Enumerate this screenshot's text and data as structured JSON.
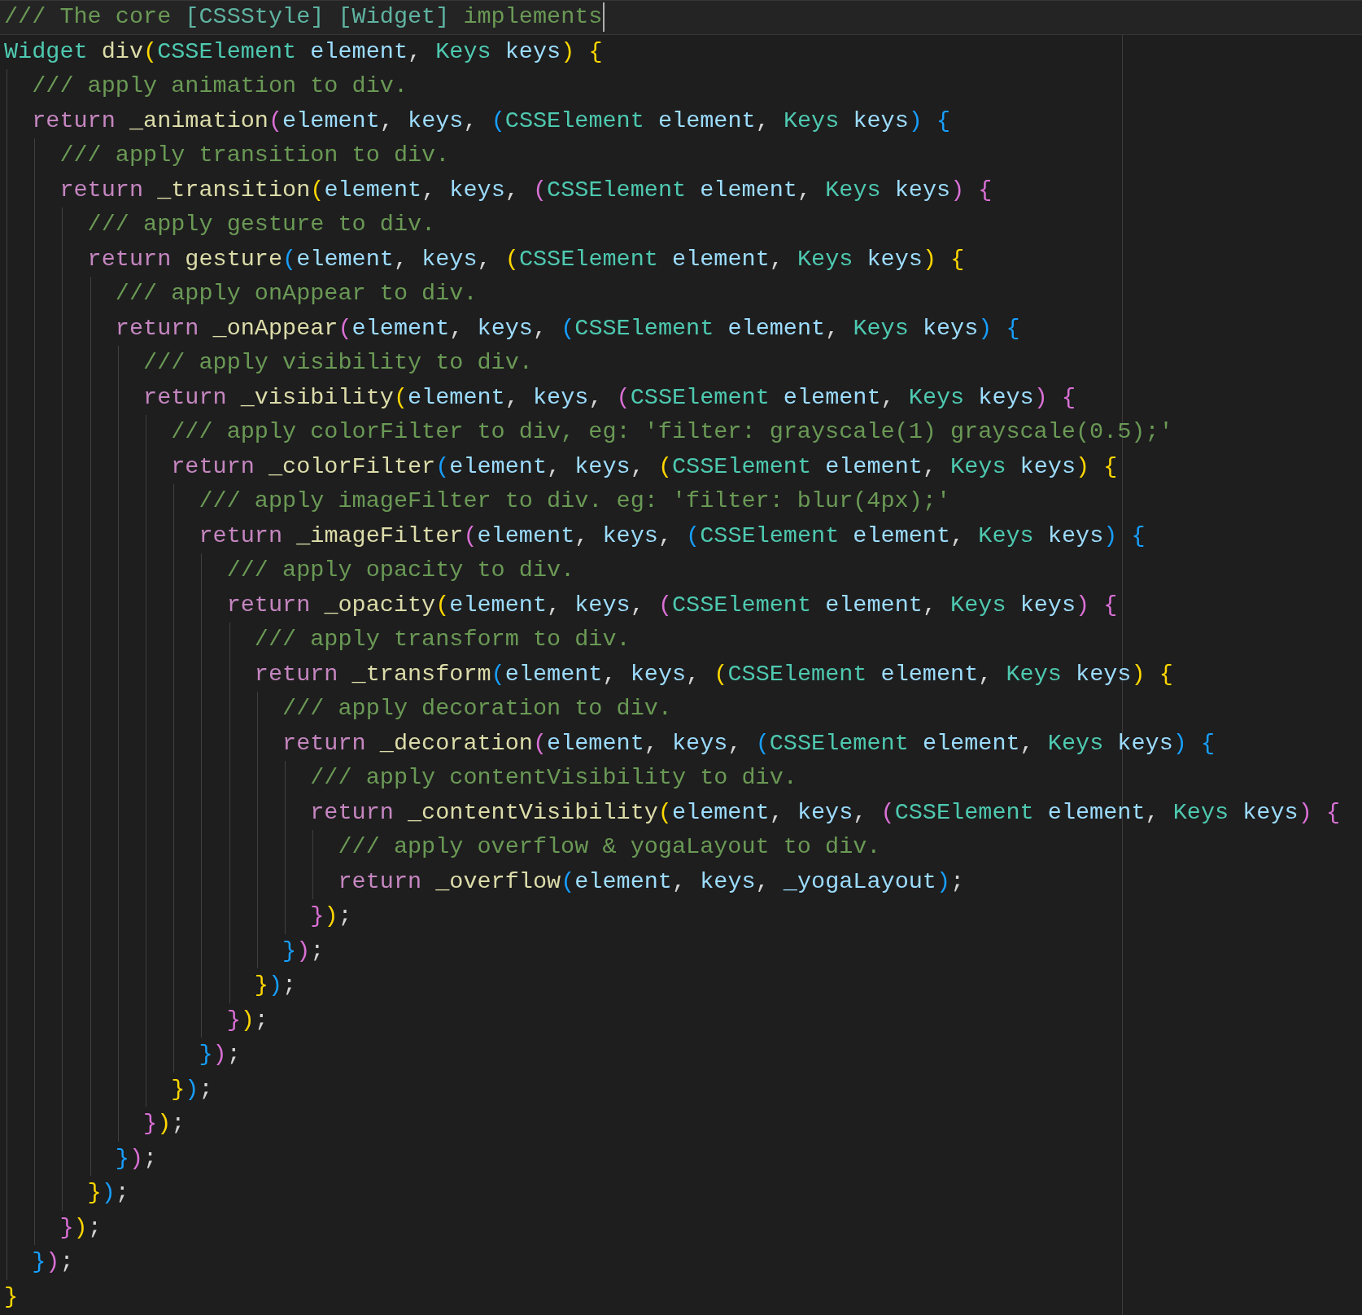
{
  "editor": {
    "lines": [
      {
        "current": true,
        "segments": [
          {
            "text": "/// The core ",
            "color": "#6a9955"
          },
          {
            "text": "[CSSStyle] ",
            "color": "#5fb3a1"
          },
          {
            "text": "[Widget]",
            "color": "#5fb3a1"
          },
          {
            "text": " implements",
            "color": "#6a9955"
          }
        ]
      },
      {
        "current": false,
        "segments": [
          {
            "text": "Widget ",
            "color": "#4ec9b0"
          },
          {
            "text": "div",
            "color": "#dcdcaa"
          },
          {
            "text": "(",
            "color": "#ffd700"
          },
          {
            "text": "CSSElement ",
            "color": "#4ec9b0"
          },
          {
            "text": "element",
            "color": "#9cdcfe"
          },
          {
            "text": ", ",
            "color": "#d4d4d4"
          },
          {
            "text": "Keys ",
            "color": "#4ec9b0"
          },
          {
            "text": "keys",
            "color": "#9cdcfe"
          },
          {
            "text": ")",
            "color": "#ffd700"
          },
          {
            "text": " {",
            "color": "#ffd700"
          }
        ]
      },
      {
        "current": false,
        "segments": [
          {
            "text": "  /// apply animation to div.",
            "color": "#6a9955"
          }
        ]
      },
      {
        "current": false,
        "segments": [
          {
            "text": "  return ",
            "color": "#c586c0"
          },
          {
            "text": "_animation",
            "color": "#dcdcaa"
          },
          {
            "text": "(",
            "color": "#da70d6"
          },
          {
            "text": "element",
            "color": "#9cdcfe"
          },
          {
            "text": ", ",
            "color": "#d4d4d4"
          },
          {
            "text": "keys",
            "color": "#9cdcfe"
          },
          {
            "text": ", ",
            "color": "#d4d4d4"
          },
          {
            "text": "(",
            "color": "#179fff"
          },
          {
            "text": "CSSElement ",
            "color": "#4ec9b0"
          },
          {
            "text": "element",
            "color": "#9cdcfe"
          },
          {
            "text": ", ",
            "color": "#d4d4d4"
          },
          {
            "text": "Keys ",
            "color": "#4ec9b0"
          },
          {
            "text": "keys",
            "color": "#9cdcfe"
          },
          {
            "text": ")",
            "color": "#179fff"
          },
          {
            "text": " {",
            "color": "#179fff"
          }
        ]
      },
      {
        "current": false,
        "segments": [
          {
            "text": "    /// apply transition to div.",
            "color": "#6a9955"
          }
        ]
      },
      {
        "current": false,
        "segments": [
          {
            "text": "    return ",
            "color": "#c586c0"
          },
          {
            "text": "_transition",
            "color": "#dcdcaa"
          },
          {
            "text": "(",
            "color": "#ffd700"
          },
          {
            "text": "element",
            "color": "#9cdcfe"
          },
          {
            "text": ", ",
            "color": "#d4d4d4"
          },
          {
            "text": "keys",
            "color": "#9cdcfe"
          },
          {
            "text": ", ",
            "color": "#d4d4d4"
          },
          {
            "text": "(",
            "color": "#da70d6"
          },
          {
            "text": "CSSElement ",
            "color": "#4ec9b0"
          },
          {
            "text": "element",
            "color": "#9cdcfe"
          },
          {
            "text": ", ",
            "color": "#d4d4d4"
          },
          {
            "text": "Keys ",
            "color": "#4ec9b0"
          },
          {
            "text": "keys",
            "color": "#9cdcfe"
          },
          {
            "text": ")",
            "color": "#da70d6"
          },
          {
            "text": " {",
            "color": "#da70d6"
          }
        ]
      },
      {
        "current": false,
        "segments": [
          {
            "text": "      /// apply gesture to div.",
            "color": "#6a9955"
          }
        ]
      },
      {
        "current": false,
        "segments": [
          {
            "text": "      return ",
            "color": "#c586c0"
          },
          {
            "text": "gesture",
            "color": "#dcdcaa"
          },
          {
            "text": "(",
            "color": "#179fff"
          },
          {
            "text": "element",
            "color": "#9cdcfe"
          },
          {
            "text": ", ",
            "color": "#d4d4d4"
          },
          {
            "text": "keys",
            "color": "#9cdcfe"
          },
          {
            "text": ", ",
            "color": "#d4d4d4"
          },
          {
            "text": "(",
            "color": "#ffd700"
          },
          {
            "text": "CSSElement ",
            "color": "#4ec9b0"
          },
          {
            "text": "element",
            "color": "#9cdcfe"
          },
          {
            "text": ", ",
            "color": "#d4d4d4"
          },
          {
            "text": "Keys ",
            "color": "#4ec9b0"
          },
          {
            "text": "keys",
            "color": "#9cdcfe"
          },
          {
            "text": ")",
            "color": "#ffd700"
          },
          {
            "text": " {",
            "color": "#ffd700"
          }
        ]
      },
      {
        "current": false,
        "segments": [
          {
            "text": "        /// apply onAppear to div.",
            "color": "#6a9955"
          }
        ]
      },
      {
        "current": false,
        "segments": [
          {
            "text": "        return ",
            "color": "#c586c0"
          },
          {
            "text": "_onAppear",
            "color": "#dcdcaa"
          },
          {
            "text": "(",
            "color": "#da70d6"
          },
          {
            "text": "element",
            "color": "#9cdcfe"
          },
          {
            "text": ", ",
            "color": "#d4d4d4"
          },
          {
            "text": "keys",
            "color": "#9cdcfe"
          },
          {
            "text": ", ",
            "color": "#d4d4d4"
          },
          {
            "text": "(",
            "color": "#179fff"
          },
          {
            "text": "CSSElement ",
            "color": "#4ec9b0"
          },
          {
            "text": "element",
            "color": "#9cdcfe"
          },
          {
            "text": ", ",
            "color": "#d4d4d4"
          },
          {
            "text": "Keys ",
            "color": "#4ec9b0"
          },
          {
            "text": "keys",
            "color": "#9cdcfe"
          },
          {
            "text": ")",
            "color": "#179fff"
          },
          {
            "text": " {",
            "color": "#179fff"
          }
        ]
      },
      {
        "current": false,
        "segments": [
          {
            "text": "          /// apply visibility to div.",
            "color": "#6a9955"
          }
        ]
      },
      {
        "current": false,
        "segments": [
          {
            "text": "          return ",
            "color": "#c586c0"
          },
          {
            "text": "_visibility",
            "color": "#dcdcaa"
          },
          {
            "text": "(",
            "color": "#ffd700"
          },
          {
            "text": "element",
            "color": "#9cdcfe"
          },
          {
            "text": ", ",
            "color": "#d4d4d4"
          },
          {
            "text": "keys",
            "color": "#9cdcfe"
          },
          {
            "text": ", ",
            "color": "#d4d4d4"
          },
          {
            "text": "(",
            "color": "#da70d6"
          },
          {
            "text": "CSSElement ",
            "color": "#4ec9b0"
          },
          {
            "text": "element",
            "color": "#9cdcfe"
          },
          {
            "text": ", ",
            "color": "#d4d4d4"
          },
          {
            "text": "Keys ",
            "color": "#4ec9b0"
          },
          {
            "text": "keys",
            "color": "#9cdcfe"
          },
          {
            "text": ")",
            "color": "#da70d6"
          },
          {
            "text": " {",
            "color": "#da70d6"
          }
        ]
      },
      {
        "current": false,
        "segments": [
          {
            "text": "            /// apply colorFilter to div, eg: 'filter: grayscale(1) grayscale(0.5);'",
            "color": "#6a9955"
          }
        ]
      },
      {
        "current": false,
        "segments": [
          {
            "text": "            return ",
            "color": "#c586c0"
          },
          {
            "text": "_colorFilter",
            "color": "#dcdcaa"
          },
          {
            "text": "(",
            "color": "#179fff"
          },
          {
            "text": "element",
            "color": "#9cdcfe"
          },
          {
            "text": ", ",
            "color": "#d4d4d4"
          },
          {
            "text": "keys",
            "color": "#9cdcfe"
          },
          {
            "text": ", ",
            "color": "#d4d4d4"
          },
          {
            "text": "(",
            "color": "#ffd700"
          },
          {
            "text": "CSSElement ",
            "color": "#4ec9b0"
          },
          {
            "text": "element",
            "color": "#9cdcfe"
          },
          {
            "text": ", ",
            "color": "#d4d4d4"
          },
          {
            "text": "Keys ",
            "color": "#4ec9b0"
          },
          {
            "text": "keys",
            "color": "#9cdcfe"
          },
          {
            "text": ")",
            "color": "#ffd700"
          },
          {
            "text": " {",
            "color": "#ffd700"
          }
        ]
      },
      {
        "current": false,
        "segments": [
          {
            "text": "              /// apply imageFilter to div. eg: 'filter: blur(4px);'",
            "color": "#6a9955"
          }
        ]
      },
      {
        "current": false,
        "segments": [
          {
            "text": "              return ",
            "color": "#c586c0"
          },
          {
            "text": "_imageFilter",
            "color": "#dcdcaa"
          },
          {
            "text": "(",
            "color": "#da70d6"
          },
          {
            "text": "element",
            "color": "#9cdcfe"
          },
          {
            "text": ", ",
            "color": "#d4d4d4"
          },
          {
            "text": "keys",
            "color": "#9cdcfe"
          },
          {
            "text": ", ",
            "color": "#d4d4d4"
          },
          {
            "text": "(",
            "color": "#179fff"
          },
          {
            "text": "CSSElement ",
            "color": "#4ec9b0"
          },
          {
            "text": "element",
            "color": "#9cdcfe"
          },
          {
            "text": ", ",
            "color": "#d4d4d4"
          },
          {
            "text": "Keys ",
            "color": "#4ec9b0"
          },
          {
            "text": "keys",
            "color": "#9cdcfe"
          },
          {
            "text": ")",
            "color": "#179fff"
          },
          {
            "text": " {",
            "color": "#179fff"
          }
        ]
      },
      {
        "current": false,
        "segments": [
          {
            "text": "                /// apply opacity to div.",
            "color": "#6a9955"
          }
        ]
      },
      {
        "current": false,
        "segments": [
          {
            "text": "                return ",
            "color": "#c586c0"
          },
          {
            "text": "_opacity",
            "color": "#dcdcaa"
          },
          {
            "text": "(",
            "color": "#ffd700"
          },
          {
            "text": "element",
            "color": "#9cdcfe"
          },
          {
            "text": ", ",
            "color": "#d4d4d4"
          },
          {
            "text": "keys",
            "color": "#9cdcfe"
          },
          {
            "text": ", ",
            "color": "#d4d4d4"
          },
          {
            "text": "(",
            "color": "#da70d6"
          },
          {
            "text": "CSSElement ",
            "color": "#4ec9b0"
          },
          {
            "text": "element",
            "color": "#9cdcfe"
          },
          {
            "text": ", ",
            "color": "#d4d4d4"
          },
          {
            "text": "Keys ",
            "color": "#4ec9b0"
          },
          {
            "text": "keys",
            "color": "#9cdcfe"
          },
          {
            "text": ")",
            "color": "#da70d6"
          },
          {
            "text": " {",
            "color": "#da70d6"
          }
        ]
      },
      {
        "current": false,
        "segments": [
          {
            "text": "                  /// apply transform to div.",
            "color": "#6a9955"
          }
        ]
      },
      {
        "current": false,
        "segments": [
          {
            "text": "                  return ",
            "color": "#c586c0"
          },
          {
            "text": "_transform",
            "color": "#dcdcaa"
          },
          {
            "text": "(",
            "color": "#179fff"
          },
          {
            "text": "element",
            "color": "#9cdcfe"
          },
          {
            "text": ", ",
            "color": "#d4d4d4"
          },
          {
            "text": "keys",
            "color": "#9cdcfe"
          },
          {
            "text": ", ",
            "color": "#d4d4d4"
          },
          {
            "text": "(",
            "color": "#ffd700"
          },
          {
            "text": "CSSElement ",
            "color": "#4ec9b0"
          },
          {
            "text": "element",
            "color": "#9cdcfe"
          },
          {
            "text": ", ",
            "color": "#d4d4d4"
          },
          {
            "text": "Keys ",
            "color": "#4ec9b0"
          },
          {
            "text": "keys",
            "color": "#9cdcfe"
          },
          {
            "text": ")",
            "color": "#ffd700"
          },
          {
            "text": " {",
            "color": "#ffd700"
          }
        ]
      },
      {
        "current": false,
        "segments": [
          {
            "text": "                    /// apply decoration to div.",
            "color": "#6a9955"
          }
        ]
      },
      {
        "current": false,
        "segments": [
          {
            "text": "                    return ",
            "color": "#c586c0"
          },
          {
            "text": "_decoration",
            "color": "#dcdcaa"
          },
          {
            "text": "(",
            "color": "#da70d6"
          },
          {
            "text": "element",
            "color": "#9cdcfe"
          },
          {
            "text": ", ",
            "color": "#d4d4d4"
          },
          {
            "text": "keys",
            "color": "#9cdcfe"
          },
          {
            "text": ", ",
            "color": "#d4d4d4"
          },
          {
            "text": "(",
            "color": "#179fff"
          },
          {
            "text": "CSSElement ",
            "color": "#4ec9b0"
          },
          {
            "text": "element",
            "color": "#9cdcfe"
          },
          {
            "text": ", ",
            "color": "#d4d4d4"
          },
          {
            "text": "Keys ",
            "color": "#4ec9b0"
          },
          {
            "text": "keys",
            "color": "#9cdcfe"
          },
          {
            "text": ")",
            "color": "#179fff"
          },
          {
            "text": " {",
            "color": "#179fff"
          }
        ]
      },
      {
        "current": false,
        "segments": [
          {
            "text": "                      /// apply contentVisibility to div.",
            "color": "#6a9955"
          }
        ]
      },
      {
        "current": false,
        "segments": [
          {
            "text": "                      return ",
            "color": "#c586c0"
          },
          {
            "text": "_contentVisibility",
            "color": "#dcdcaa"
          },
          {
            "text": "(",
            "color": "#ffd700"
          },
          {
            "text": "element",
            "color": "#9cdcfe"
          },
          {
            "text": ", ",
            "color": "#d4d4d4"
          },
          {
            "text": "keys",
            "color": "#9cdcfe"
          },
          {
            "text": ", ",
            "color": "#d4d4d4"
          },
          {
            "text": "(",
            "color": "#da70d6"
          },
          {
            "text": "CSSElement ",
            "color": "#4ec9b0"
          },
          {
            "text": "element",
            "color": "#9cdcfe"
          },
          {
            "text": ", ",
            "color": "#d4d4d4"
          },
          {
            "text": "Keys ",
            "color": "#4ec9b0"
          },
          {
            "text": "keys",
            "color": "#9cdcfe"
          },
          {
            "text": ")",
            "color": "#da70d6"
          },
          {
            "text": " {",
            "color": "#da70d6"
          }
        ]
      },
      {
        "current": false,
        "segments": [
          {
            "text": "                        /// apply overflow & yogaLayout to div.",
            "color": "#6a9955"
          }
        ]
      },
      {
        "current": false,
        "segments": [
          {
            "text": "                        return ",
            "color": "#c586c0"
          },
          {
            "text": "_overflow",
            "color": "#dcdcaa"
          },
          {
            "text": "(",
            "color": "#179fff"
          },
          {
            "text": "element",
            "color": "#9cdcfe"
          },
          {
            "text": ", ",
            "color": "#d4d4d4"
          },
          {
            "text": "keys",
            "color": "#9cdcfe"
          },
          {
            "text": ", ",
            "color": "#d4d4d4"
          },
          {
            "text": "_yogaLayout",
            "color": "#9cdcfe"
          },
          {
            "text": ")",
            "color": "#179fff"
          },
          {
            "text": ";",
            "color": "#d4d4d4"
          }
        ]
      },
      {
        "current": false,
        "segments": [
          {
            "text": "                      }",
            "color": "#da70d6"
          },
          {
            "text": ")",
            "color": "#ffd700"
          },
          {
            "text": ";",
            "color": "#d4d4d4"
          }
        ]
      },
      {
        "current": false,
        "segments": [
          {
            "text": "                    }",
            "color": "#179fff"
          },
          {
            "text": ")",
            "color": "#da70d6"
          },
          {
            "text": ";",
            "color": "#d4d4d4"
          }
        ]
      },
      {
        "current": false,
        "segments": [
          {
            "text": "                  }",
            "color": "#ffd700"
          },
          {
            "text": ")",
            "color": "#179fff"
          },
          {
            "text": ";",
            "color": "#d4d4d4"
          }
        ]
      },
      {
        "current": false,
        "segments": [
          {
            "text": "                }",
            "color": "#da70d6"
          },
          {
            "text": ")",
            "color": "#ffd700"
          },
          {
            "text": ";",
            "color": "#d4d4d4"
          }
        ]
      },
      {
        "current": false,
        "segments": [
          {
            "text": "              }",
            "color": "#179fff"
          },
          {
            "text": ")",
            "color": "#da70d6"
          },
          {
            "text": ";",
            "color": "#d4d4d4"
          }
        ]
      },
      {
        "current": false,
        "segments": [
          {
            "text": "            }",
            "color": "#ffd700"
          },
          {
            "text": ")",
            "color": "#179fff"
          },
          {
            "text": ";",
            "color": "#d4d4d4"
          }
        ]
      },
      {
        "current": false,
        "segments": [
          {
            "text": "          }",
            "color": "#da70d6"
          },
          {
            "text": ")",
            "color": "#ffd700"
          },
          {
            "text": ";",
            "color": "#d4d4d4"
          }
        ]
      },
      {
        "current": false,
        "segments": [
          {
            "text": "        }",
            "color": "#179fff"
          },
          {
            "text": ")",
            "color": "#da70d6"
          },
          {
            "text": ";",
            "color": "#d4d4d4"
          }
        ]
      },
      {
        "current": false,
        "segments": [
          {
            "text": "      }",
            "color": "#ffd700"
          },
          {
            "text": ")",
            "color": "#179fff"
          },
          {
            "text": ";",
            "color": "#d4d4d4"
          }
        ]
      },
      {
        "current": false,
        "segments": [
          {
            "text": "    }",
            "color": "#da70d6"
          },
          {
            "text": ")",
            "color": "#ffd700"
          },
          {
            "text": ";",
            "color": "#d4d4d4"
          }
        ]
      },
      {
        "current": false,
        "segments": [
          {
            "text": "  }",
            "color": "#179fff"
          },
          {
            "text": ")",
            "color": "#da70d6"
          },
          {
            "text": ";",
            "color": "#d4d4d4"
          }
        ]
      },
      {
        "current": false,
        "segments": [
          {
            "text": "}",
            "color": "#ffd700"
          }
        ]
      }
    ]
  }
}
